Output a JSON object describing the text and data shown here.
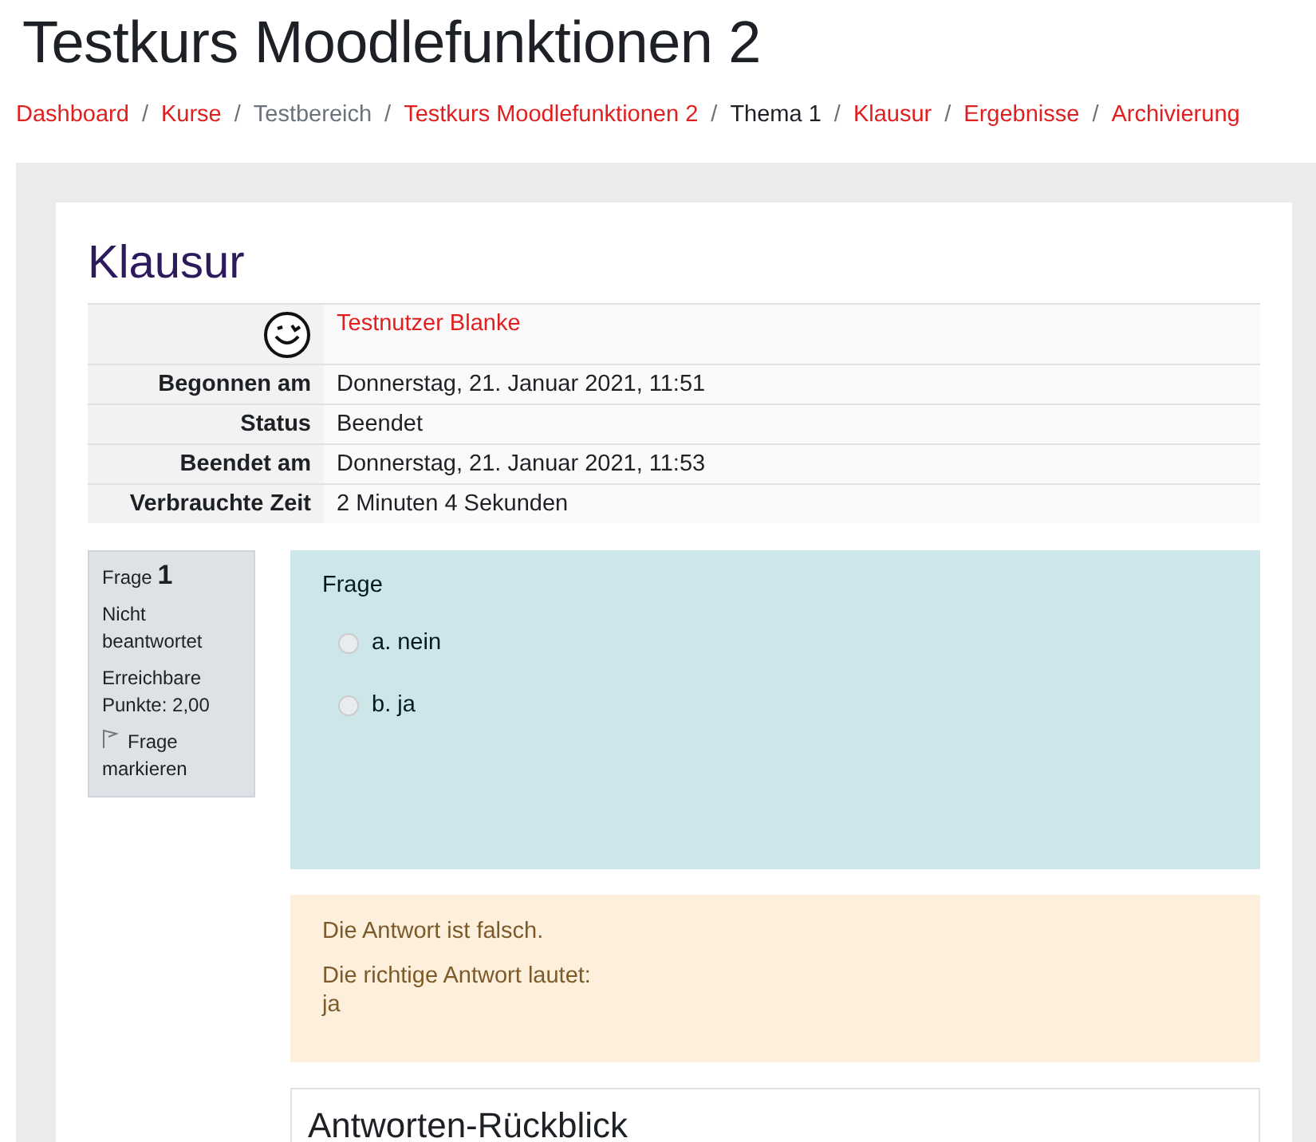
{
  "page_title": "Testkurs Moodlefunktionen 2",
  "breadcrumb": [
    {
      "label": "Dashboard",
      "kind": "link"
    },
    {
      "separator": "/",
      "label": "Kurse",
      "kind": "link"
    },
    {
      "separator": "/",
      "label": "Testbereich",
      "kind": "plain"
    },
    {
      "separator": "/",
      "label": "Testkurs Moodlefunktionen 2",
      "kind": "link"
    },
    {
      "separator": "/",
      "label": "Thema 1",
      "kind": "current"
    },
    {
      "separator": "/",
      "label": "Klausur",
      "kind": "link"
    },
    {
      "separator": "/",
      "label": "Ergebnisse",
      "kind": "link"
    },
    {
      "separator": "/",
      "label": "Archivierung",
      "kind": "link"
    }
  ],
  "quiz_title": "Klausur",
  "summary": [
    {
      "kind": "user",
      "value": "Testnutzer Blanke"
    },
    {
      "kind": "field",
      "label": "Begonnen am",
      "value": "Donnerstag, 21. Januar 2021, 11:51"
    },
    {
      "kind": "field",
      "label": "Status",
      "value": "Beendet"
    },
    {
      "kind": "field",
      "label": "Beendet am",
      "value": "Donnerstag, 21. Januar 2021, 11:53"
    },
    {
      "kind": "field",
      "label": "Verbrauchte Zeit",
      "value": "2 Minuten 4 Sekunden"
    }
  ],
  "question_info": {
    "label": "Frage",
    "number": "1",
    "state": "Nicht beantwortet",
    "points": "Erreichbare Punkte: 2,00",
    "flag": "Frage markieren"
  },
  "question": {
    "text": "Frage",
    "answers": [
      {
        "label": "a. nein",
        "selected": false
      },
      {
        "label": "b. ja",
        "selected": false
      }
    ]
  },
  "feedback": {
    "verdict": "Die Antwort ist falsch.",
    "correct_label": "Die richtige Antwort lautet:",
    "correct_answer": "ja"
  },
  "review_heading": "Antworten-Rückblick"
}
